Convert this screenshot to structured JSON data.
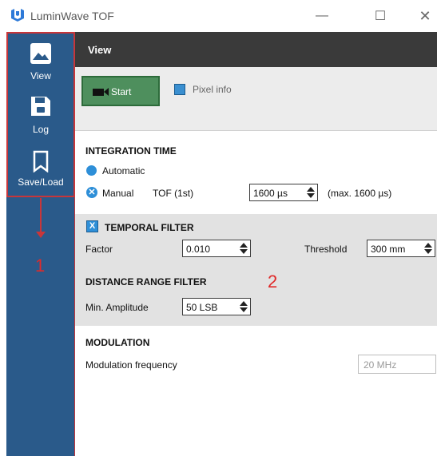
{
  "window": {
    "title": "LuminWave TOF",
    "min_glyph": "—",
    "max_glyph": "☐",
    "close_glyph": "✕"
  },
  "sidebar": {
    "items": [
      {
        "label": "View",
        "icon": "image-icon"
      },
      {
        "label": "Log",
        "icon": "save-icon"
      },
      {
        "label": "Save/Load",
        "icon": "bookmark-icon"
      }
    ],
    "annotation": "1"
  },
  "header": {
    "title": "View"
  },
  "toolbar": {
    "start_label": "Start",
    "pixel_info_label": "Pixel info"
  },
  "integration": {
    "title": "INTEGRATION TIME",
    "automatic_label": "Automatic",
    "manual_label": "Manual",
    "tof_label": "TOF (1st)",
    "tof_value": "1600 µs",
    "max_label": "(max. 1600 µs)"
  },
  "temporal_filter": {
    "title": "TEMPORAL FILTER",
    "check_glyph": "X",
    "factor_label": "Factor",
    "factor_value": "0.010",
    "threshold_label": "Threshold",
    "threshold_value": "300 mm"
  },
  "distance_filter": {
    "title": "DISTANCE RANGE FILTER",
    "min_amp_label": "Min. Amplitude",
    "min_amp_value": "50 LSB",
    "annotation": "2"
  },
  "modulation": {
    "title": "MODULATION",
    "freq_label": "Modulation frequency",
    "freq_value": "20 MHz"
  },
  "colors": {
    "sidebar": "#2a5a8a",
    "header": "#3a3a3a",
    "start_button": "#4e8f5d",
    "accent": "#2e8fd8",
    "annotation": "#e02a2a"
  }
}
